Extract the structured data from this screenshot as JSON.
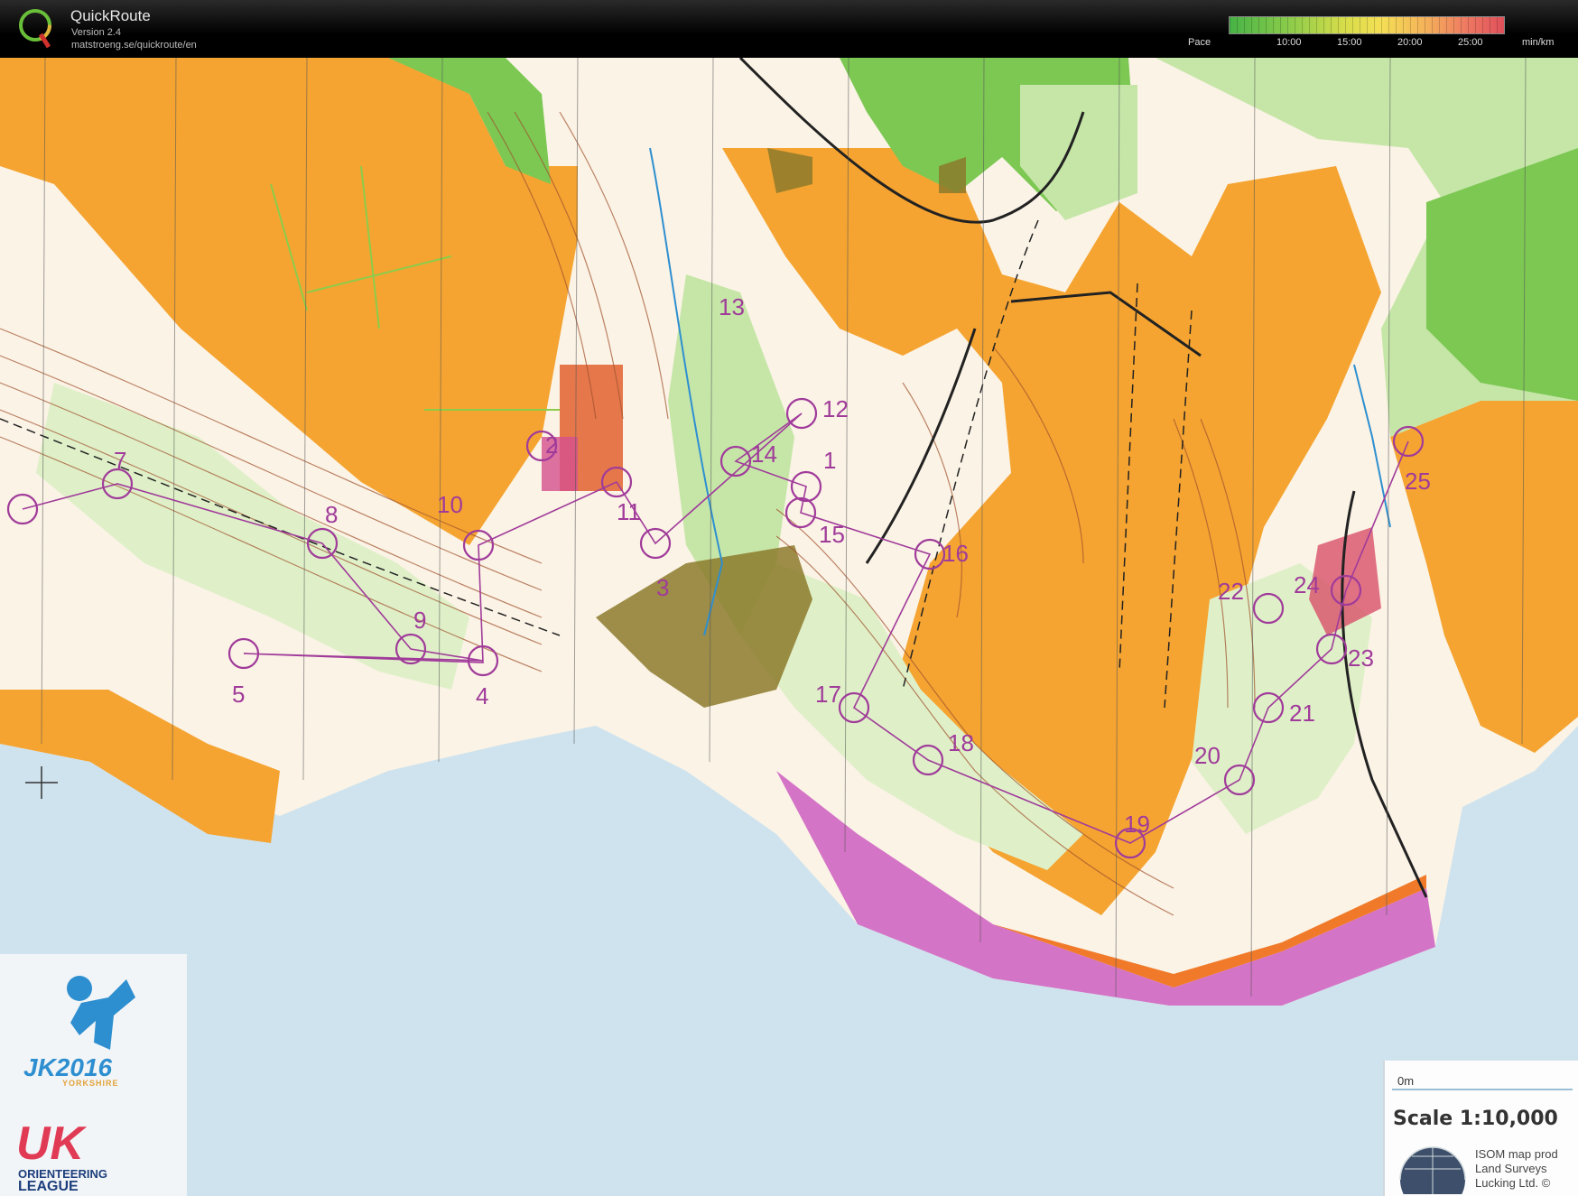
{
  "app": {
    "name": "QuickRoute",
    "version": "Version 2.4",
    "url": "matstroeng.se/quickroute/en",
    "logo_letter": "Q"
  },
  "pace_legend": {
    "label": "Pace",
    "ticks": [
      "10:00",
      "15:00",
      "20:00",
      "25:00"
    ],
    "unit": "min/km",
    "colors": [
      "#46b346",
      "#8ccc4a",
      "#d8dd4a",
      "#f4df55",
      "#f5b05a",
      "#ee7a62",
      "#e0505a"
    ]
  },
  "map": {
    "course_color": "#a03b9a",
    "colors": {
      "open_land": "#f5a431",
      "forest_green": "#7cc853",
      "light_green": "#c6e6a8",
      "water": "#cfe3ee",
      "contour": "#a0522d",
      "rough_open": "#fde7b8",
      "settlement": "#8c7a2b"
    },
    "controls": [
      {
        "label": "1"
      },
      {
        "label": "2"
      },
      {
        "label": "3"
      },
      {
        "label": "4"
      },
      {
        "label": "5"
      },
      {
        "label": "7"
      },
      {
        "label": "8"
      },
      {
        "label": "9"
      },
      {
        "label": "10"
      },
      {
        "label": "11"
      },
      {
        "label": "12"
      },
      {
        "label": "13"
      },
      {
        "label": "14"
      },
      {
        "label": "15"
      },
      {
        "label": "16"
      },
      {
        "label": "17"
      },
      {
        "label": "18"
      },
      {
        "label": "19"
      },
      {
        "label": "20"
      },
      {
        "label": "21"
      },
      {
        "label": "22"
      },
      {
        "label": "23"
      },
      {
        "label": "24"
      },
      {
        "label": "25"
      }
    ],
    "scale": {
      "zero_label": "0m",
      "text": "Scale 1:10,000"
    },
    "isom_note": "ISOM map prod Land Surveys Lucking Ltd. ©",
    "jk_logo": {
      "main": "JK2016",
      "sub": "YORKSHIRE"
    },
    "league_logo": {
      "main": "UK",
      "sub1": "ORIENTEERING",
      "sub2": "LEAGUE"
    }
  }
}
